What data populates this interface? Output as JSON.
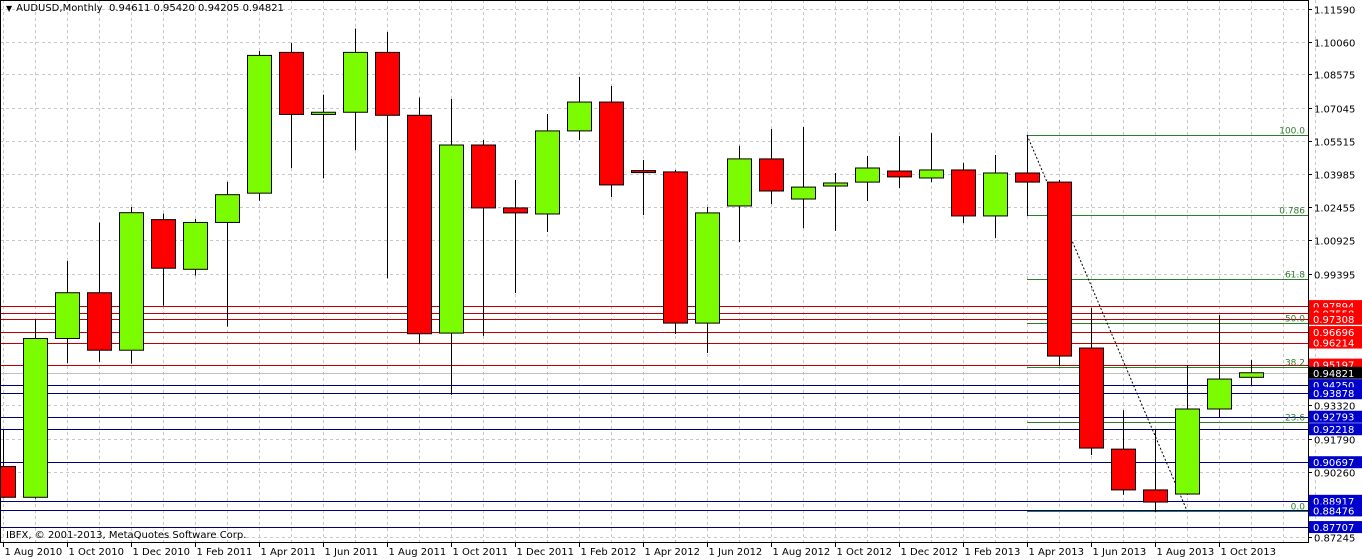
{
  "header": {
    "menu_icon": "triangle-down-icon",
    "symbol_label": "AUDUSD,Monthly",
    "ohlc": "0.94611 0.95420 0.94205 0.94821"
  },
  "copyright": "IBFX, © 2001-2013, MetaQuotes Software Corp.",
  "colors": {
    "bull": "#7CFC00",
    "bear": "#FF0000",
    "red_level": "#C00000",
    "blue_level": "#00007F",
    "fib": "#2E7D2E",
    "grid": "#C8C8C8"
  },
  "chart_data": {
    "type": "candlestick",
    "symbol": "AUDUSD",
    "timeframe": "Monthly",
    "y_range": [
      0.87245,
      1.1159
    ],
    "price_ticks": [
      "1.11590",
      "1.10060",
      "1.08575",
      "1.07045",
      "1.05515",
      "1.03985",
      "1.02455",
      "1.00925",
      "0.99395",
      "0.93320",
      "0.91790",
      "0.90260",
      "0.87245"
    ],
    "x_tick_labels": [
      "1 Aug 2010",
      "1 Oct 2010",
      "1 Dec 2010",
      "1 Feb 2011",
      "1 Apr 2011",
      "1 Jun 2011",
      "1 Aug 2011",
      "1 Oct 2011",
      "1 Dec 2011",
      "1 Feb 2012",
      "1 Apr 2012",
      "1 Jun 2012",
      "1 Aug 2012",
      "1 Oct 2012",
      "1 Dec 2012",
      "1 Feb 2013",
      "1 Apr 2013",
      "1 Jun 2013",
      "1 Aug 2013",
      "1 Oct 2013"
    ],
    "candles": [
      {
        "date": "Aug 2010",
        "o": 0.905,
        "h": 0.9219,
        "l": 0.8905,
        "c": 0.8908
      },
      {
        "date": "Sep 2010",
        "o": 0.8908,
        "h": 0.9727,
        "l": 0.8902,
        "c": 0.964
      },
      {
        "date": "Oct 2010",
        "o": 0.964,
        "h": 0.9997,
        "l": 0.9526,
        "c": 0.9851
      },
      {
        "date": "Nov 2010",
        "o": 0.9851,
        "h": 1.0175,
        "l": 0.9532,
        "c": 0.9586
      },
      {
        "date": "Dec 2010",
        "o": 0.9586,
        "h": 1.0246,
        "l": 0.9524,
        "c": 1.022
      },
      {
        "date": "Jan 2011",
        "o": 1.0188,
        "h": 1.0216,
        "l": 0.9791,
        "c": 0.9964
      },
      {
        "date": "Feb 2011",
        "o": 0.9959,
        "h": 1.0191,
        "l": 0.993,
        "c": 1.0175
      },
      {
        "date": "Mar 2011",
        "o": 1.0175,
        "h": 1.0362,
        "l": 0.9695,
        "c": 1.0303
      },
      {
        "date": "Apr 2011",
        "o": 1.031,
        "h": 1.0965,
        "l": 1.0275,
        "c": 1.0945
      },
      {
        "date": "May 2011",
        "o": 1.0959,
        "h": 1.1002,
        "l": 1.0426,
        "c": 1.0673
      },
      {
        "date": "Jun 2011",
        "o": 1.0673,
        "h": 1.0764,
        "l": 1.0378,
        "c": 1.0683
      },
      {
        "date": "Jul 2011",
        "o": 1.0683,
        "h": 1.1069,
        "l": 1.0509,
        "c": 1.0959
      },
      {
        "date": "Aug 2011",
        "o": 1.0959,
        "h": 1.1053,
        "l": 0.9918,
        "c": 1.0669
      },
      {
        "date": "Sep 2011",
        "o": 1.0669,
        "h": 1.0751,
        "l": 0.9616,
        "c": 0.9662
      },
      {
        "date": "Oct 2011",
        "o": 0.9665,
        "h": 1.0744,
        "l": 0.938,
        "c": 1.0532
      },
      {
        "date": "Nov 2011",
        "o": 1.0532,
        "h": 1.0555,
        "l": 0.9652,
        "c": 1.0242
      },
      {
        "date": "Dec 2011",
        "o": 1.0242,
        "h": 1.0371,
        "l": 0.985,
        "c": 1.0219
      },
      {
        "date": "Jan 2012",
        "o": 1.0214,
        "h": 1.0675,
        "l": 1.0131,
        "c": 1.0597
      },
      {
        "date": "Feb 2012",
        "o": 1.0597,
        "h": 1.0846,
        "l": 1.0555,
        "c": 1.073
      },
      {
        "date": "Mar 2012",
        "o": 1.073,
        "h": 1.0804,
        "l": 1.0292,
        "c": 1.0348
      },
      {
        "date": "Apr 2012",
        "o": 1.0414,
        "h": 1.0463,
        "l": 1.0209,
        "c": 1.0412
      },
      {
        "date": "May 2012",
        "o": 1.0408,
        "h": 1.0417,
        "l": 0.9661,
        "c": 0.9711
      },
      {
        "date": "Jun 2012",
        "o": 0.9711,
        "h": 1.0246,
        "l": 0.9573,
        "c": 1.0219
      },
      {
        "date": "Jul 2012",
        "o": 1.0251,
        "h": 1.0528,
        "l": 1.0085,
        "c": 1.0468
      },
      {
        "date": "Aug 2012",
        "o": 1.0468,
        "h": 1.0606,
        "l": 1.026,
        "c": 1.032
      },
      {
        "date": "Sep 2012",
        "o": 1.0283,
        "h": 1.0615,
        "l": 1.0149,
        "c": 1.0338
      },
      {
        "date": "Oct 2012",
        "o": 1.0343,
        "h": 1.0403,
        "l": 1.0136,
        "c": 1.0357
      },
      {
        "date": "Nov 2012",
        "o": 1.0361,
        "h": 1.0482,
        "l": 1.0274,
        "c": 1.0426
      },
      {
        "date": "Dec 2012",
        "o": 1.0412,
        "h": 1.0573,
        "l": 1.0334,
        "c": 1.0385
      },
      {
        "date": "Jan 2013",
        "o": 1.038,
        "h": 1.0587,
        "l": 1.0361,
        "c": 1.0417
      },
      {
        "date": "Feb 2013",
        "o": 1.0417,
        "h": 1.0449,
        "l": 1.0172,
        "c": 1.0205
      },
      {
        "date": "Mar 2013",
        "o": 1.0205,
        "h": 1.0486,
        "l": 1.0103,
        "c": 1.0403
      },
      {
        "date": "Apr 2013",
        "o": 1.0403,
        "h": 1.0578,
        "l": 1.0205,
        "c": 1.0361
      },
      {
        "date": "May 2013",
        "o": 1.0361,
        "h": 1.0371,
        "l": 0.9513,
        "c": 0.9559
      },
      {
        "date": "Jun 2013",
        "o": 0.9596,
        "h": 0.9781,
        "l": 0.9103,
        "c": 0.9135
      },
      {
        "date": "Jul 2013",
        "o": 0.913,
        "h": 0.931,
        "l": 0.8919,
        "c": 0.8942
      },
      {
        "date": "Aug 2013",
        "o": 0.8942,
        "h": 0.9223,
        "l": 0.884,
        "c": 0.8886
      },
      {
        "date": "Sep 2013",
        "o": 0.8923,
        "h": 0.9518,
        "l": 0.8919,
        "c": 0.9315
      },
      {
        "date": "Oct 2013",
        "o": 0.9315,
        "h": 0.9748,
        "l": 0.9278,
        "c": 0.9453
      },
      {
        "date": "Nov 2013",
        "o": 0.94611,
        "h": 0.9542,
        "l": 0.94205,
        "c": 0.94821
      }
    ],
    "levels": [
      {
        "label": "0.97894",
        "price": 0.97894,
        "kind": "red"
      },
      {
        "label": "0.97558",
        "price": 0.97558,
        "kind": "red"
      },
      {
        "label": "0.97308",
        "price": 0.97308,
        "kind": "red"
      },
      {
        "label": "0.96696",
        "price": 0.96696,
        "kind": "red"
      },
      {
        "label": "0.96214",
        "price": 0.96214,
        "kind": "red"
      },
      {
        "label": "0.95197",
        "price": 0.95197,
        "kind": "red"
      },
      {
        "label": "0.94250",
        "price": 0.9425,
        "kind": "blue"
      },
      {
        "label": "0.93878",
        "price": 0.93878,
        "kind": "blue"
      },
      {
        "label": "0.92793",
        "price": 0.92793,
        "kind": "blue"
      },
      {
        "label": "0.92218",
        "price": 0.92218,
        "kind": "blue"
      },
      {
        "label": "0.90697",
        "price": 0.90697,
        "kind": "blue"
      },
      {
        "label": "0.88917",
        "price": 0.88917,
        "kind": "blue"
      },
      {
        "label": "0.88476",
        "price": 0.88476,
        "kind": "blue"
      },
      {
        "label": "0.87707",
        "price": 0.87707,
        "kind": "blue"
      }
    ],
    "bid": {
      "label": "0.94821",
      "price": 0.94821
    },
    "fibonacci": {
      "from_candle": "Apr 2013",
      "high": 1.0578,
      "low": 0.8846,
      "levels": [
        {
          "label": "100.0",
          "ratio": 1.0
        },
        {
          "label": "0.786",
          "ratio": 0.786
        },
        {
          "label": "61.8",
          "ratio": 0.618
        },
        {
          "label": "50.0",
          "ratio": 0.5
        },
        {
          "label": "38.2",
          "ratio": 0.382
        },
        {
          "label": "23.6",
          "ratio": 0.236
        },
        {
          "label": "0.0",
          "ratio": 0.0
        }
      ]
    },
    "trendline": {
      "from": {
        "candle": "Apr 2013",
        "price": 1.0578
      },
      "to": {
        "candle": "Sep 2013",
        "price": 0.8846
      },
      "style": "dotted"
    }
  }
}
